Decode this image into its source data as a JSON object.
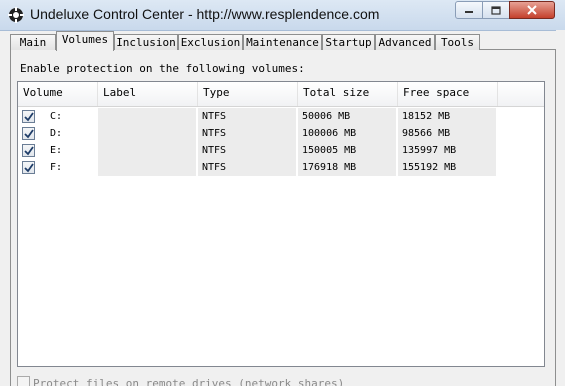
{
  "window": {
    "title": "Undeluxe Control Center - http://www.resplendence.com"
  },
  "tabs": [
    {
      "label": "Main",
      "active": false
    },
    {
      "label": "Volumes",
      "active": true
    },
    {
      "label": "Inclusion",
      "active": false
    },
    {
      "label": "Exclusion",
      "active": false
    },
    {
      "label": "Maintenance",
      "active": false
    },
    {
      "label": "Startup",
      "active": false
    },
    {
      "label": "Advanced",
      "active": false
    },
    {
      "label": "Tools",
      "active": false
    }
  ],
  "volumes": {
    "caption": "Enable protection on the following volumes:",
    "columns": [
      "Volume",
      "Label",
      "Type",
      "Total size",
      "Free space"
    ],
    "rows": [
      {
        "checked": true,
        "volume": "C:",
        "label": "",
        "type": "NTFS",
        "total": "50006 MB",
        "free": "18152 MB"
      },
      {
        "checked": true,
        "volume": "D:",
        "label": "",
        "type": "NTFS",
        "total": "100006 MB",
        "free": "98566 MB"
      },
      {
        "checked": true,
        "volume": "E:",
        "label": "",
        "type": "NTFS",
        "total": "150005 MB",
        "free": "135997 MB"
      },
      {
        "checked": true,
        "volume": "F:",
        "label": "",
        "type": "NTFS",
        "total": "176918 MB",
        "free": "155192 MB"
      }
    ]
  },
  "options": {
    "remote_label": "Protect files on remote drives (network shares)"
  }
}
